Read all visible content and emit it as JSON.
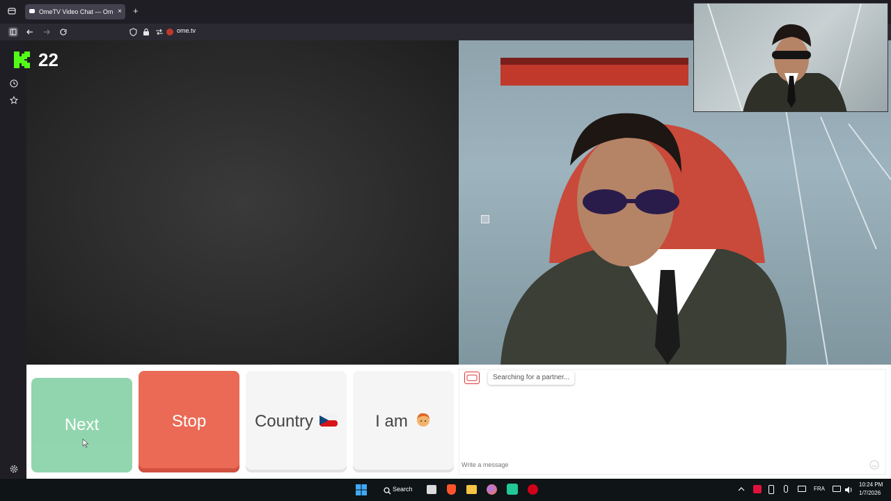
{
  "browser": {
    "tab_title": "OmeTV Video Chat — Om",
    "tab_close": "×",
    "new_tab": "+",
    "url": "ome.tv"
  },
  "overlay": {
    "kick_count": "22"
  },
  "controls": {
    "next": "Next",
    "stop": "Stop",
    "country": "Country",
    "i_am": "I am"
  },
  "chat": {
    "status": "Searching for a partner...",
    "placeholder": "Write a message"
  },
  "taskbar": {
    "search": "Search",
    "lang": "FRA",
    "time": "10:24 PM",
    "date": "1/7/2026"
  },
  "colors": {
    "next": "#86d1a6",
    "stop": "#ea6a55",
    "kick_green": "#53fc18"
  }
}
